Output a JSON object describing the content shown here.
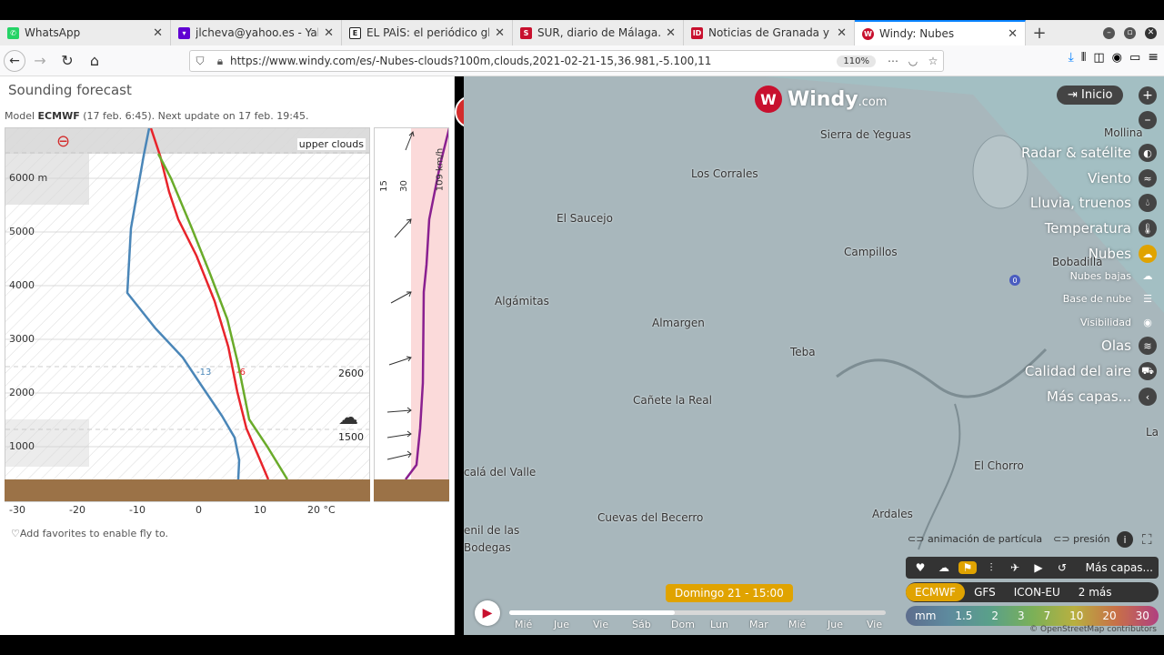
{
  "tabs": [
    {
      "label": "WhatsApp",
      "icon": "whatsapp-icon",
      "color": "#25d366",
      "active": false
    },
    {
      "label": "jlcheva@yahoo.es - Yaho",
      "icon": "yahoo-icon",
      "color": "#6001d2",
      "active": false
    },
    {
      "label": "EL PAÍS: el periódico glo",
      "icon": "elpais-icon",
      "color": "#222222",
      "active": false
    },
    {
      "label": "SUR, diario de Málaga. N",
      "icon": "sur-icon",
      "color": "#c8102e",
      "active": false
    },
    {
      "label": "Noticias de Granada y Pr",
      "icon": "ideal-icon",
      "color": "#c8102e",
      "active": false
    },
    {
      "label": "Windy: Nubes",
      "icon": "windy-icon",
      "color": "#c8102e",
      "active": true
    }
  ],
  "url": "https://www.windy.com/es/-Nubes-clouds?100m,clouds,2021-02-21-15,36.981,-5.100,11",
  "zoom": "110%",
  "sounding": {
    "title": "Sounding forecast",
    "model_prefix": "Model ",
    "model_name": "ECMWF",
    "model_suffix": " (17 feb. 6:45). Next update on 17 feb. 19:45.",
    "cloud_label": "upper clouds",
    "altitudes": [
      "6000 m",
      "5000",
      "4000",
      "3000",
      "2000",
      "1000"
    ],
    "temp_dew_label": "-13",
    "temp_label": "-6",
    "level_2600": "2600",
    "level_1500": "1500",
    "x_ticks": [
      "-30",
      "-20",
      "-10",
      "0",
      "10",
      "20 °C"
    ],
    "wind_ticks": [
      "15",
      "30"
    ],
    "wind_max": "109 km/h",
    "favorites": "Add favorites to enable fly to."
  },
  "map": {
    "logo_main": "Windy",
    "logo_suffix": ".com",
    "home": "Inicio",
    "towns": [
      {
        "name": "Sierra de Yeguas"
      },
      {
        "name": "Los Corrales"
      },
      {
        "name": "El Saucejo"
      },
      {
        "name": "Campillos"
      },
      {
        "name": "Mollina"
      },
      {
        "name": "Bobadilla"
      },
      {
        "name": "Algámitas"
      },
      {
        "name": "Almargen"
      },
      {
        "name": "Teba"
      },
      {
        "name": "Cañete la Real"
      },
      {
        "name": "La"
      },
      {
        "name": "El Chorro"
      },
      {
        "name": "calá del Valle"
      },
      {
        "name": "Ardales"
      },
      {
        "name": "Cuevas del Becerro"
      },
      {
        "name": "enil de las"
      },
      {
        "name": "Bodegas"
      }
    ],
    "layers": [
      {
        "label": "Radar & satélite",
        "size": "big",
        "icon": "radar-icon"
      },
      {
        "label": "Viento",
        "size": "big",
        "icon": "wind-icon"
      },
      {
        "label": "Lluvia, truenos",
        "size": "big",
        "icon": "rain-icon"
      },
      {
        "label": "Temperatura",
        "size": "big",
        "icon": "thermometer-icon"
      },
      {
        "label": "Nubes",
        "size": "big",
        "icon": "cloud-icon",
        "active": true
      },
      {
        "label": "Nubes bajas",
        "size": "small",
        "icon": "low-cloud-icon"
      },
      {
        "label": "Base de nube",
        "size": "small",
        "icon": "cloud-base-icon"
      },
      {
        "label": "Visibilidad",
        "size": "small",
        "icon": "eye-icon"
      },
      {
        "label": "Olas",
        "size": "big",
        "icon": "waves-icon"
      },
      {
        "label": "Calidad del aire",
        "size": "big",
        "icon": "car-icon"
      },
      {
        "label": "Más capas...",
        "size": "big",
        "icon": "chevron-left-icon"
      }
    ],
    "particles": "animación de partícula",
    "pressure": "presión",
    "more_layers": "Más capas...",
    "models": [
      "ECMWF",
      "GFS",
      "ICON-EU",
      "2 más"
    ],
    "legend": [
      "mm",
      "1.5",
      "2",
      "3",
      "7",
      "10",
      "20",
      "30"
    ],
    "time_bubble": "Domingo 21 - 15:00",
    "days": [
      "Mié",
      "Jue",
      "Vie",
      "Sáb",
      "Dom",
      "Lun",
      "Mar",
      "Mié",
      "Jue",
      "Vie"
    ],
    "progress": 0.44,
    "osm": "© OpenStreetMap contributors"
  }
}
